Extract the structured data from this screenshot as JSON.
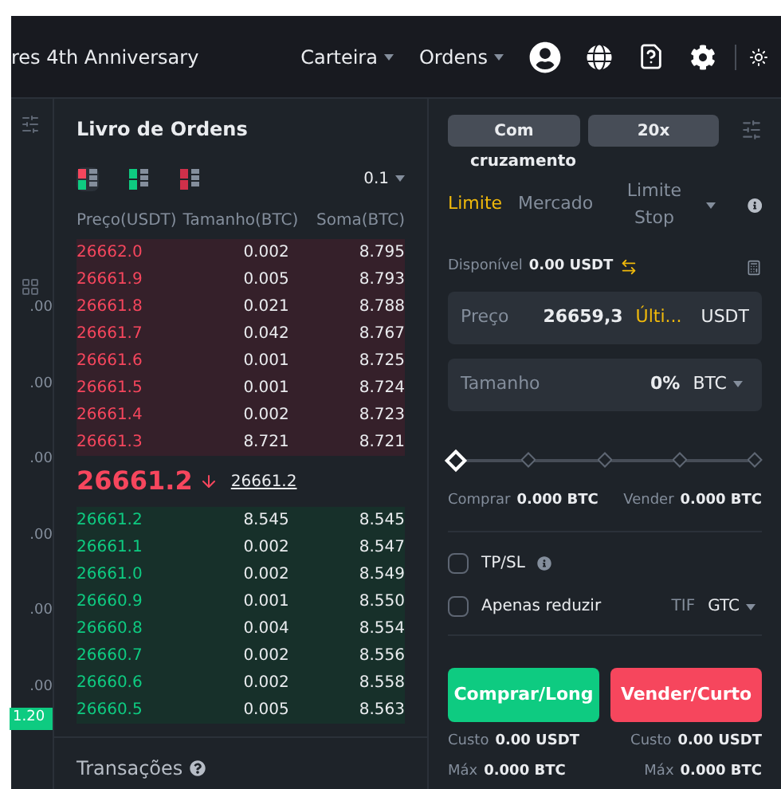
{
  "header": {
    "title": "res 4th Anniversary",
    "menus": [
      {
        "label": "Carteira"
      },
      {
        "label": "Ordens"
      }
    ]
  },
  "left_strip": {
    "values": [
      ".00",
      ".00",
      ".00",
      ".00",
      ".00",
      ".00"
    ],
    "badge": "1.20"
  },
  "order_book": {
    "title": "Livro de Ordens",
    "views": [
      {
        "kind": "both",
        "selected": true
      },
      {
        "kind": "bids",
        "selected": false
      },
      {
        "kind": "asks",
        "selected": false
      }
    ],
    "precision": "0.1",
    "columns": [
      "Preço(USDT)",
      "Tamanho(BTC)",
      "Soma(BTC)"
    ],
    "asks": [
      [
        "26662.0",
        "0.002",
        "8.795"
      ],
      [
        "26661.9",
        "0.005",
        "8.793"
      ],
      [
        "26661.8",
        "0.021",
        "8.788"
      ],
      [
        "26661.7",
        "0.042",
        "8.767"
      ],
      [
        "26661.6",
        "0.001",
        "8.725"
      ],
      [
        "26661.5",
        "0.001",
        "8.724"
      ],
      [
        "26661.4",
        "0.002",
        "8.723"
      ],
      [
        "26661.3",
        "8.721",
        "8.721"
      ]
    ],
    "last_price": "26661.2",
    "mark_price": "26661.2",
    "bids": [
      [
        "26661.2",
        "8.545",
        "8.545"
      ],
      [
        "26661.1",
        "0.002",
        "8.547"
      ],
      [
        "26661.0",
        "0.002",
        "8.549"
      ],
      [
        "26660.9",
        "0.001",
        "8.550"
      ],
      [
        "26660.8",
        "0.004",
        "8.554"
      ],
      [
        "26660.7",
        "0.002",
        "8.556"
      ],
      [
        "26660.6",
        "0.002",
        "8.558"
      ],
      [
        "26660.5",
        "0.005",
        "8.563"
      ]
    ],
    "trades_title": "Transações"
  },
  "order_form": {
    "margin_mode": "Com",
    "margin_mode_cont": "cruzamento",
    "leverage": "20x",
    "order_types": [
      {
        "label": "Limite",
        "selected": true
      },
      {
        "label": "Mercado",
        "selected": false
      },
      {
        "label": "Limite Stop",
        "selected": false
      }
    ],
    "available_label": "Disponível",
    "available_value": "0.00 USDT",
    "price": {
      "label": "Preço",
      "value": "26659,3",
      "hint": "Últi...",
      "unit": "USDT"
    },
    "size": {
      "label": "Tamanho",
      "value": "0%",
      "unit": "BTC"
    },
    "slider": {
      "level": 0
    },
    "buy_label": "Comprar",
    "buy_value": "0.000 BTC",
    "sell_label": "Vender",
    "sell_value": "0.000 BTC",
    "options": [
      {
        "label": "TP/SL",
        "checked": false
      },
      {
        "label": "Apenas reduzir",
        "checked": false
      }
    ],
    "tif_label": "TIF",
    "tif_value": "GTC",
    "buy_button": "Comprar/Long",
    "sell_button": "Vender/Curto",
    "costs": [
      {
        "label": "Custo",
        "value": "0.00 USDT"
      },
      {
        "label": "Custo",
        "value": "0.00 USDT"
      }
    ],
    "max": [
      {
        "label": "Máx",
        "value": "0.000 BTC"
      },
      {
        "label": "Máx",
        "value": "0.000 BTC"
      }
    ]
  }
}
